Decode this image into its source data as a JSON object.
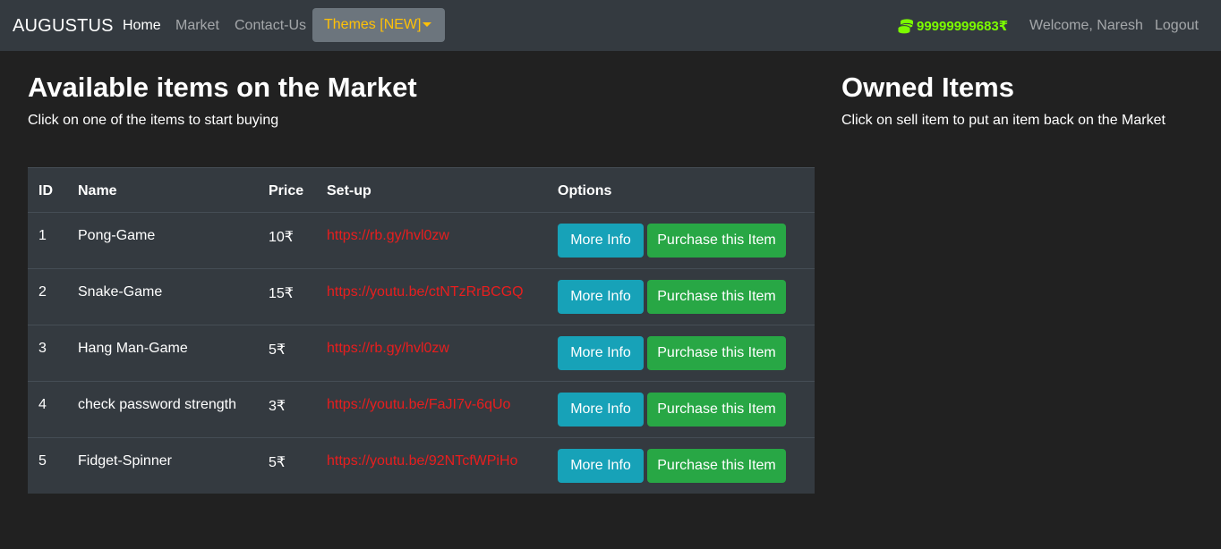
{
  "nav": {
    "brand": "AUGUSTUS",
    "links": [
      "Home",
      "Market",
      "Contact-Us"
    ],
    "themes_label": "Themes [NEW]",
    "budget": "99999999683₹",
    "welcome": "Welcome, Naresh",
    "logout": "Logout"
  },
  "market": {
    "title": "Available items on the Market",
    "subtitle": "Click on one of the items to start buying",
    "columns": [
      "ID",
      "Name",
      "Price",
      "Set-up",
      "Options"
    ],
    "rows": [
      {
        "id": "1",
        "name": "Pong-Game",
        "price": "10₹",
        "setup": "https://rb.gy/hvl0zw",
        "more": "More Info",
        "buy": "Purchase this Item"
      },
      {
        "id": "2",
        "name": "Snake-Game",
        "price": "15₹",
        "setup": "https://youtu.be/ctNTzRrBCGQ",
        "more": "More Info",
        "buy": "Purchase this Item"
      },
      {
        "id": "3",
        "name": "Hang Man-Game",
        "price": "5₹",
        "setup": "https://rb.gy/hvl0zw",
        "more": "More Info",
        "buy": "Purchase this Item"
      },
      {
        "id": "4",
        "name": "check password strength",
        "price": "3₹",
        "setup": "https://youtu.be/FaJI7v-6qUo",
        "more": "More Info",
        "buy": "Purchase this Item"
      },
      {
        "id": "5",
        "name": "Fidget-Spinner",
        "price": "5₹",
        "setup": "https://youtu.be/92NTcfWPiHo",
        "more": "More Info",
        "buy": "Purchase this Item"
      }
    ]
  },
  "owned": {
    "title": "Owned Items",
    "subtitle": "Click on sell item to put an item back on the Market"
  },
  "colors": {
    "accent_budget": "#7cfc00",
    "themes_text": "#ffc107",
    "link_red": "#e81e1e",
    "info": "#17a2b8",
    "success": "#28a745"
  }
}
